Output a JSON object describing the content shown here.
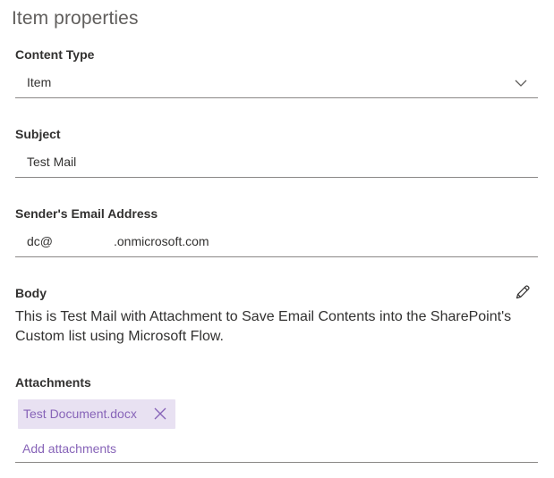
{
  "panel": {
    "title": "Item properties"
  },
  "fields": {
    "content_type": {
      "label": "Content Type",
      "value": "Item"
    },
    "subject": {
      "label": "Subject",
      "value": "Test Mail"
    },
    "sender_email": {
      "label": "Sender's Email Address",
      "value_prefix": "dc@",
      "value_suffix": ".onmicrosoft.com"
    },
    "body": {
      "label": "Body",
      "value": "This is Test Mail with Attachment to Save Email Contents into the SharePoint's Custom list using Microsoft Flow."
    },
    "attachments": {
      "label": "Attachments",
      "files": [
        "Test Document.docx"
      ],
      "add_label": "Add attachments"
    }
  },
  "icons": {
    "dropdown": "chevron-down-icon",
    "edit": "pencil-icon",
    "remove": "close-icon"
  },
  "colors": {
    "text": "#323130",
    "title": "#605e5c",
    "accent": "#8764b8",
    "chip_background": "#e8e1f2",
    "underline": "#8a8886"
  }
}
